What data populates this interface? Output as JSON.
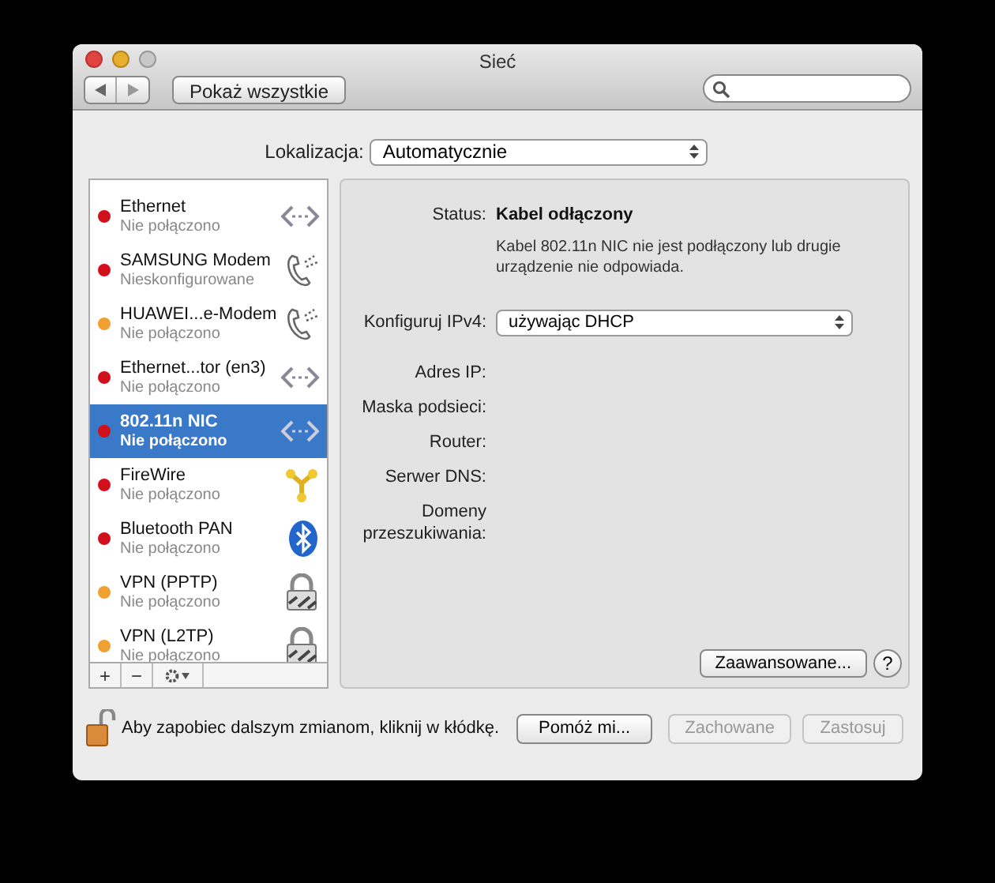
{
  "window": {
    "title": "Sieć"
  },
  "toolbar": {
    "show_all": "Pokaż wszystkie"
  },
  "location": {
    "label": "Lokalizacja:",
    "value": "Automatycznie"
  },
  "services": [
    {
      "name": "Ethernet",
      "status": "Nie połączono",
      "color": "#d0101a",
      "kind": "ethernet",
      "selected": false
    },
    {
      "name": "SAMSUNG Modem",
      "status": "Nieskonfigurowane",
      "color": "#d0101a",
      "kind": "modem",
      "selected": false
    },
    {
      "name": "HUAWEI...e-Modem",
      "status": "Nie połączono",
      "color": "#f0a030",
      "kind": "modem",
      "selected": false
    },
    {
      "name": "Ethernet...tor (en3)",
      "status": "Nie połączono",
      "color": "#d0101a",
      "kind": "ethernet",
      "selected": false
    },
    {
      "name": "802.11n NIC",
      "status": "Nie połączono",
      "color": "#d0101a",
      "kind": "ethernet",
      "selected": true
    },
    {
      "name": "FireWire",
      "status": "Nie połączono",
      "color": "#d0101a",
      "kind": "firewire",
      "selected": false
    },
    {
      "name": "Bluetooth PAN",
      "status": "Nie połączono",
      "color": "#d0101a",
      "kind": "bluetooth",
      "selected": false
    },
    {
      "name": "VPN (PPTP)",
      "status": "Nie połączono",
      "color": "#f0a030",
      "kind": "vpn",
      "selected": false
    },
    {
      "name": "VPN (L2TP)",
      "status": "Nie połączono",
      "color": "#f0a030",
      "kind": "vpn",
      "selected": false
    }
  ],
  "list_buttons": [
    "+",
    "−"
  ],
  "detail": {
    "status_label": "Status:",
    "status_value": "Kabel odłączony",
    "status_note": "Kabel 802.11n NIC nie jest podłączony lub drugie urządzenie nie odpowiada.",
    "configure_label": "Konfiguruj IPv4:",
    "configure_value": "używając DHCP",
    "fields": [
      "Adres IP:",
      "Maska podsieci:",
      "Router:",
      "Serwer DNS:",
      "Domeny przeszukiwania:"
    ],
    "advanced": "Zaawansowane...",
    "help": "?"
  },
  "footer": {
    "lock_text": "Aby zapobiec dalszym zmianom, kliknij w kłódkę.",
    "assist": "Pomóż mi...",
    "revert": {
      "label": "Zachowane",
      "disabled": true
    },
    "apply": {
      "label": "Zastosuj",
      "disabled": true
    }
  }
}
